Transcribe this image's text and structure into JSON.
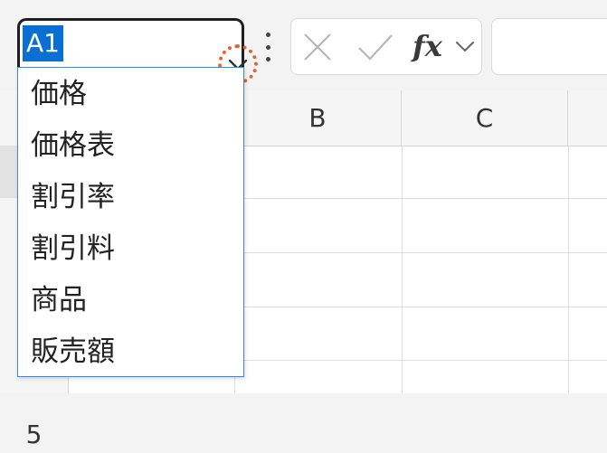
{
  "name_box": {
    "value": "A1",
    "dropdown_icon": "chevron-down-icon"
  },
  "more_icon": "more-vertical-icon",
  "formula_bar": {
    "cancel_icon": "close-icon",
    "enter_icon": "check-icon",
    "insert_function_label": "fx",
    "insert_function_menu_icon": "chevron-down-icon",
    "formula_value": ""
  },
  "grid": {
    "column_headers": [
      "B",
      "C"
    ],
    "row_headers": [
      "5"
    ]
  },
  "name_list": {
    "items": [
      "価格",
      "価格表",
      "割引率",
      "割引料",
      "商品",
      "販売額"
    ]
  },
  "colors": {
    "selection": "#0a6fd2",
    "highlight_circle": "#e0642e",
    "list_border": "#4a86c5"
  }
}
